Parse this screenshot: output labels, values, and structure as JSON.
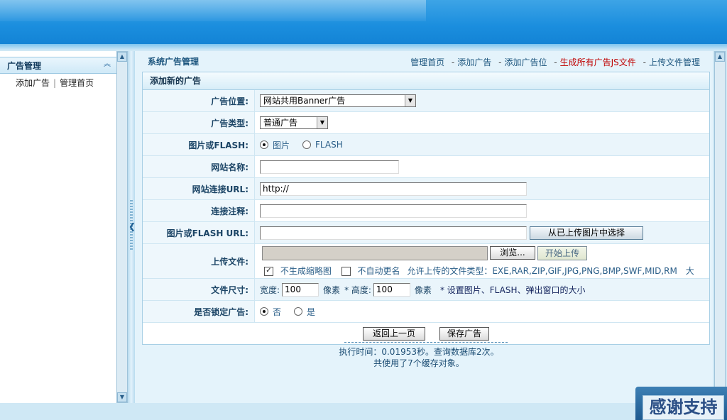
{
  "sidebar": {
    "title": "广告管理",
    "links": [
      "添加广告",
      "管理首页"
    ]
  },
  "main": {
    "crumb_title": "系统广告管理",
    "topnav": {
      "home": "管理首页",
      "add_ad": "添加广告",
      "add_slot": "添加广告位",
      "gen_js": "生成所有广告JS文件",
      "upload_mgr": "上传文件管理"
    },
    "panel_title": "添加新的广告",
    "fields": {
      "position_label": "广告位置:",
      "position_value": "网站共用Banner广告",
      "type_label": "广告类型:",
      "type_value": "普通广告",
      "media_label": "图片或FLASH:",
      "media_opt1": "图片",
      "media_opt2": "FLASH",
      "sitename_label": "网站名称:",
      "sitename_value": "",
      "url_label": "网站连接URL:",
      "url_value": "http://",
      "note_label": "连接注释:",
      "note_value": "",
      "img_url_label": "图片或FLASH URL:",
      "img_url_value": "",
      "choose_uploaded": "从已上传图片中选择",
      "upload_label": "上传文件:",
      "browse": "浏览...",
      "start_upload": "开始上传",
      "no_thumb": "不生成缩略图",
      "no_rename": "不自动更名",
      "allowed_types": "允许上传的文件类型：EXE,RAR,ZIP,GIF,JPG,PNG,BMP,SWF,MID,RM　大",
      "size_label": "文件尺寸:",
      "width_label": "宽度:",
      "width_value": "100",
      "px1": "像素",
      "height_label": "* 高度:",
      "height_value": "100",
      "px2": "像素",
      "size_hint": "* 设置图片、FLASH、弹出窗口的大小",
      "lock_label": "是否锁定广告:",
      "lock_no": "否",
      "lock_yes": "是"
    },
    "buttons": {
      "back": "返回上一页",
      "save": "保存广告"
    },
    "footer": {
      "line1": "执行时间：0.01953秒。查询数据库2次。",
      "line2": "共使用了7个缓存对象。"
    }
  },
  "stamp_text": "感谢支持"
}
